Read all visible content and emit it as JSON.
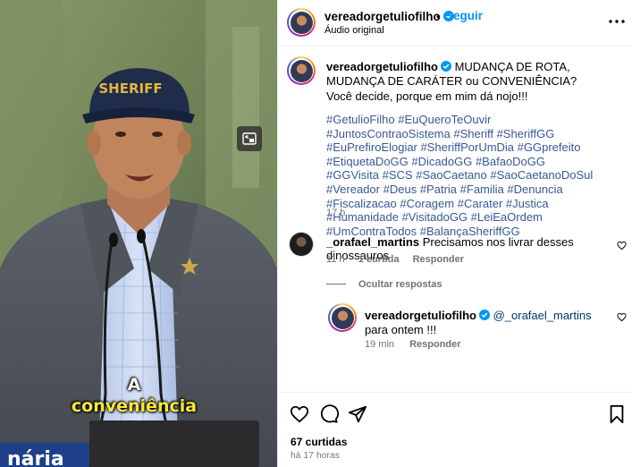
{
  "media": {
    "caption_line1": "A",
    "caption_line2": "conveniência",
    "cap_text": "SHERIFF",
    "podium_text": "nária"
  },
  "header": {
    "username": "vereadorgetuliofilho",
    "dot": "•",
    "follow_label": "Seguir",
    "audio_label": "Áudio original"
  },
  "post": {
    "username": "vereadorgetuliofilho",
    "text": "MUDANÇA DE ROTA, MUDANÇA DE CARÁTER ou CONVENIÊNCIA? Você decide, porque em mim dá nojo!!!",
    "hashtags": [
      "#GetulioFilho",
      "#EuQueroTeOuvir",
      "#JuntosContraoSistema",
      "#Sheriff",
      "#SheriffGG",
      "#EuPrefiroElogiar",
      "#SheriffPorUmDia",
      "#GGprefeito",
      "#EtiquetaDoGG",
      "#DicadoGG",
      "#BafaoDoGG",
      "#GGVisita",
      "#SCS",
      "#SaoCaetano",
      "#SaoCaetanoDoSul",
      "#Vereador",
      "#Deus",
      "#Patria",
      "#Familia",
      "#Denuncia",
      "#Fiscalizacao",
      "#Coragem",
      "#Carater",
      "#Justica",
      "#Humanidade",
      "#VisitadoGG",
      "#LeiEaOrdem",
      "#UmContraTodos",
      "#BalançaSheriffGG"
    ],
    "time": "17 h"
  },
  "comment": {
    "username": "_orafael_martins",
    "text": "Precisamos nos livrar desses dinossauros",
    "time": "11 h",
    "likes": "1 curtida",
    "reply_label": "Responder",
    "hide_replies_label": "Ocultar respostas"
  },
  "reply": {
    "username": "vereadorgetuliofilho",
    "mention": "@_orafael_martins",
    "text": "para ontem !!!",
    "time": "19 min",
    "reply_label": "Responder"
  },
  "footer": {
    "likes": "67 curtidas",
    "time_ago": "há 17 horas"
  },
  "colors": {
    "follow": "#0095f6",
    "hashtag": "#385898",
    "muted": "#737373",
    "caption_yellow": "#f6e73a"
  },
  "icons": [
    "pip-icon",
    "verified-icon",
    "more-icon",
    "heart-icon",
    "comment-icon",
    "share-icon",
    "bookmark-icon"
  ]
}
